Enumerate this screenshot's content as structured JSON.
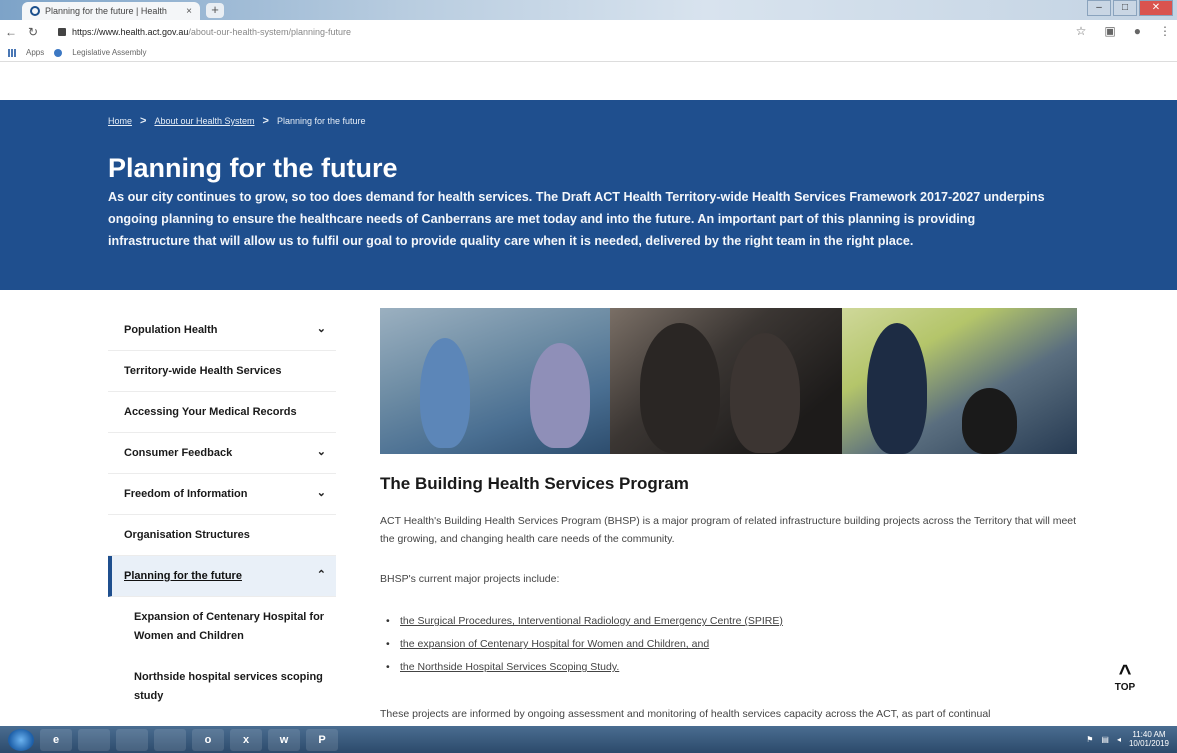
{
  "browser": {
    "tab_title": "Planning for the future | Health",
    "tab_close": "×",
    "new_tab": "+",
    "url_domain": "https://www.health.act.gov.au",
    "url_path": "/about-our-health-system/planning-future",
    "bookmarks": [
      "Apps",
      "Legislative Assembly"
    ]
  },
  "breadcrumb": {
    "home": "Home",
    "about": "About our Health System",
    "current": "Planning for the future"
  },
  "hero": {
    "title": "Planning for the future",
    "description": "As our city continues to grow, so too does demand for health services. The Draft ACT Health Territory-wide Health Services Framework 2017-2027 underpins ongoing planning to ensure the healthcare needs of Canberrans are met today and into the future. An important part of this planning is providing infrastructure that will allow us to fulfil our goal to provide quality care when it is needed, delivered by the right team in the right place."
  },
  "sidebar": {
    "items": [
      {
        "label": "Population Health",
        "expandable": true
      },
      {
        "label": "Territory-wide Health Services",
        "expandable": false
      },
      {
        "label": "Accessing Your Medical Records",
        "expandable": false
      },
      {
        "label": "Consumer Feedback",
        "expandable": true
      },
      {
        "label": "Freedom of Information",
        "expandable": true
      },
      {
        "label": "Organisation Structures",
        "expandable": false
      },
      {
        "label": "Planning for the future",
        "expandable": true,
        "active": true
      }
    ],
    "subitems": [
      "Expansion of Centenary Hospital for Women and Children",
      "Northside hospital services scoping study"
    ]
  },
  "content": {
    "heading": "The Building Health Services Program",
    "intro": "ACT Health's Building Health Services Program (BHSP) is a major program of related infrastructure building projects across the Territory that will meet the growing, and changing health care needs of the community.",
    "projects_lead": "BHSP's current major projects include:",
    "projects": [
      "the Surgical Procedures, Interventional Radiology and Emergency Centre (SPIRE)",
      "the expansion of Centenary Hospital for Women and Children, and",
      "the Northside Hospital Services Scoping Study."
    ],
    "closing": "These projects are informed by ongoing assessment and monitoring of health services capacity across the ACT, as part of continual"
  },
  "top_button": {
    "arrow": "^",
    "label": "TOP"
  },
  "taskbar": {
    "apps": [
      "e",
      "",
      "",
      "",
      "o",
      "x",
      "w",
      "P"
    ],
    "time": "11:40 AM",
    "date": "10/01/2019"
  },
  "colors": {
    "brand_blue": "#1f4f8e",
    "active_bg": "#e9f0f8"
  }
}
